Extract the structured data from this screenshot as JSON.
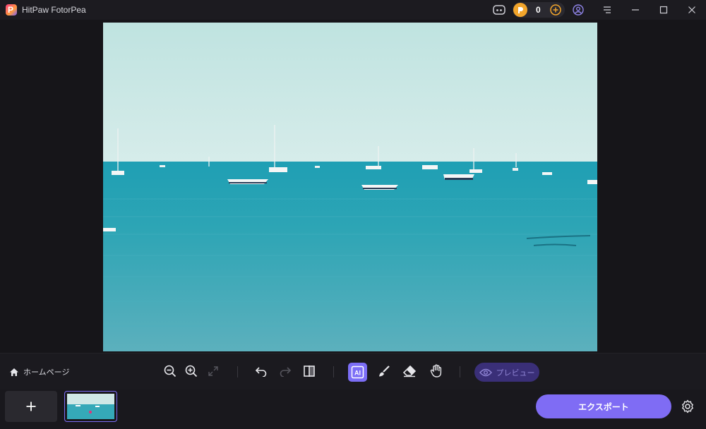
{
  "titlebar": {
    "app_name": "HitPaw FotorPea",
    "logo_letter": "P",
    "credits": "0",
    "icons": [
      "discord-icon",
      "coin-icon",
      "add-credits-icon",
      "account-icon",
      "menu-icon",
      "minimize-icon",
      "maximize-icon",
      "close-icon"
    ]
  },
  "toolbar": {
    "home_label": "ホームページ",
    "tools": [
      "zoom-out-icon",
      "zoom-in-icon",
      "fit-screen-icon",
      "undo-icon",
      "redo-icon",
      "compare-icon",
      "ai-select-icon",
      "brush-icon",
      "eraser-icon",
      "hand-icon"
    ],
    "ai_label": "AI",
    "preview_label": "プレビュー"
  },
  "bottombar": {
    "add_label": "+",
    "export_label": "エクスポート"
  },
  "colors": {
    "accent": "#7f6cf4",
    "preview_bg": "#3a2f78",
    "coin": "#f2a52b",
    "background": "#161519"
  }
}
